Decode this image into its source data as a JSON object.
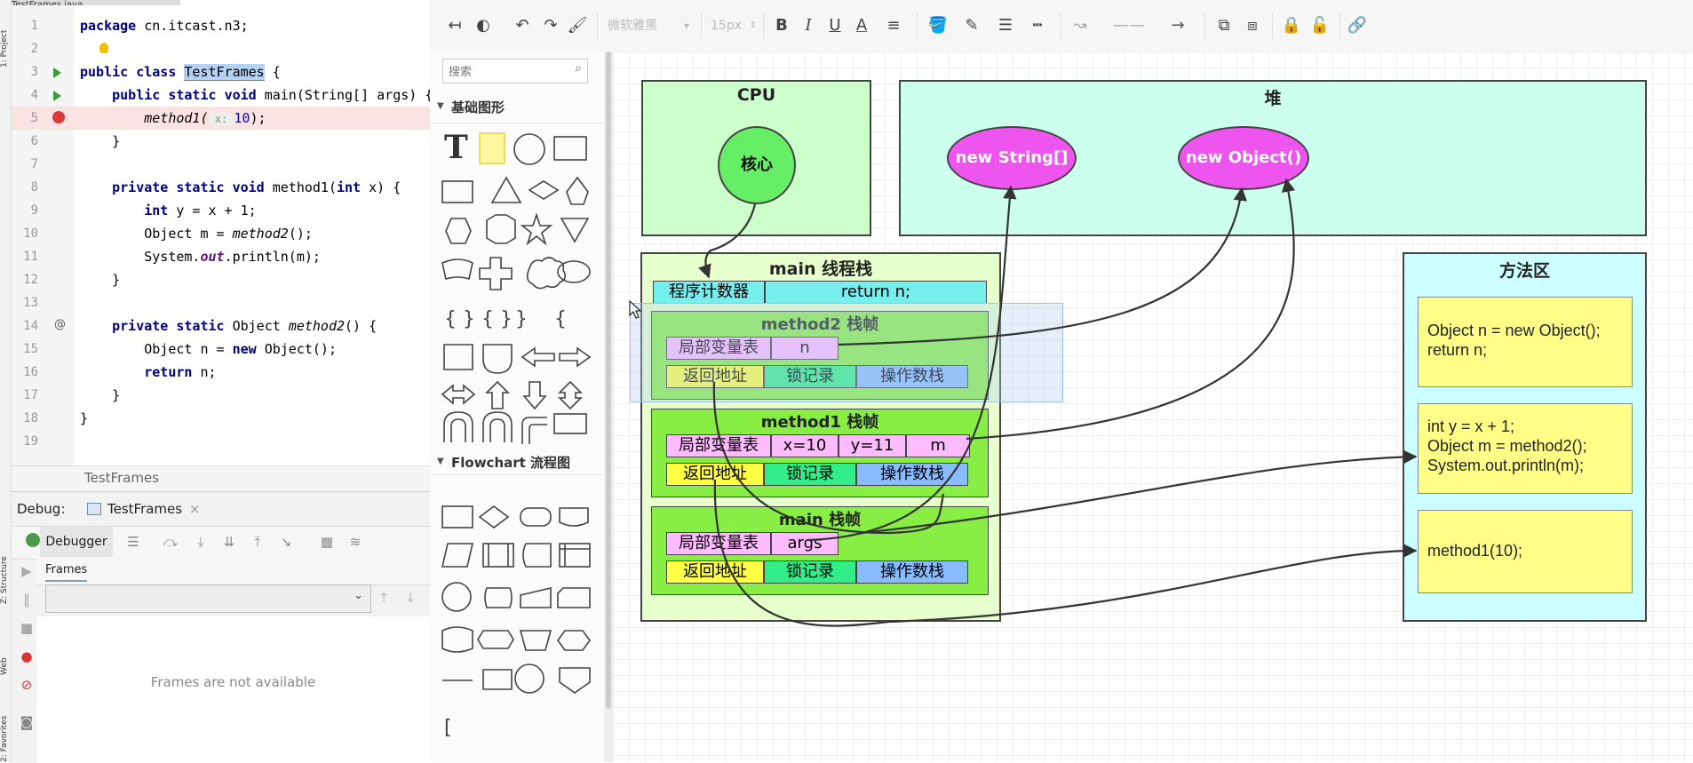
{
  "ide": {
    "file_tab": "TestFrames.java",
    "side_tabs": [
      "1: Project",
      "Z: Structure",
      "Web",
      "2: Favorites"
    ],
    "code": [
      {
        "n": "1",
        "text": "package cn.itcast.n3;"
      },
      {
        "n": "2",
        "text": ""
      },
      {
        "n": "3",
        "text_pre": "public class ",
        "sel": "TestFrames",
        "text_post": " {"
      },
      {
        "n": "4",
        "text": "    public static void main(String[] args) {"
      },
      {
        "n": "5",
        "text_pre": "        ",
        "call": "method1(",
        "hint": " x: ",
        "arg": "10",
        "text_post": ");"
      },
      {
        "n": "6",
        "text": "    }"
      },
      {
        "n": "7",
        "text": ""
      },
      {
        "n": "8",
        "text": "    private static void method1(int x) {"
      },
      {
        "n": "9",
        "text": "        int y = x + 1;"
      },
      {
        "n": "10",
        "text": "        Object m = method2();"
      },
      {
        "n": "11",
        "text": "        System.out.println(m);"
      },
      {
        "n": "12",
        "text": "    }"
      },
      {
        "n": "13",
        "text": ""
      },
      {
        "n": "14",
        "text": "    private static Object method2() {"
      },
      {
        "n": "15",
        "text": "        Object n = new Object();"
      },
      {
        "n": "16",
        "text": "        return n;"
      },
      {
        "n": "17",
        "text": "    }"
      },
      {
        "n": "18",
        "text": "}"
      },
      {
        "n": "19",
        "text": ""
      }
    ],
    "footer": "TestFrames",
    "debug": {
      "label": "Debug:",
      "session": "TestFrames",
      "tab_debugger": "Debugger",
      "tab_frames": "Frames",
      "empty_msg": "Frames are not available"
    }
  },
  "editor_toolbar": {
    "font_name": "微软雅黑",
    "font_size": "15px"
  },
  "shapes": {
    "search_placeholder": "搜索",
    "section_basic": "基础图形",
    "section_flow": "Flowchart 流程图"
  },
  "diagram": {
    "cpu_title": "CPU",
    "core_label": "核心",
    "heap_title": "堆",
    "heap_items": [
      "new String[]",
      "new Object()"
    ],
    "stack_title": "main 线程栈",
    "pc_label": "程序计数器",
    "pc_value": "return n;",
    "method2_frame": {
      "title": "method2 栈帧",
      "locals_label": "局部变量表",
      "locals": [
        "n"
      ],
      "return_addr": "返回地址",
      "lock": "锁记录",
      "operand": "操作数栈"
    },
    "method1_frame": {
      "title": "method1 栈帧",
      "locals_label": "局部变量表",
      "locals": [
        "x=10",
        "y=11",
        "m"
      ],
      "return_addr": "返回地址",
      "lock": "锁记录",
      "operand": "操作数栈"
    },
    "main_frame": {
      "title": "main 栈帧",
      "locals_label": "局部变量表",
      "locals": [
        "args"
      ],
      "return_addr": "返回地址",
      "lock": "锁记录",
      "operand": "操作数栈"
    },
    "method_area_title": "方法区",
    "method_area_items": [
      "Object n = new Object();\nreturn n;",
      "int y = x + 1;\nObject m = method2();\nSystem.out.println(m);",
      "method1(10);"
    ]
  },
  "colors": {
    "cpu_bg": "#ccffcc",
    "heap_bg": "#ccffee",
    "stack_bg": "#e6ffcc",
    "frame_bg": "#88ee44",
    "core": "#66ee66",
    "heap_ellipse": "#ee55ee",
    "pc_cell": "#77eeee",
    "locals_cell": "#ffbbff",
    "return_cell": "#ffff44",
    "lock_cell": "#33ee88",
    "operand_cell": "#88bbff",
    "method_area_bg": "#ccffff",
    "method_area_item": "#ffff88"
  }
}
